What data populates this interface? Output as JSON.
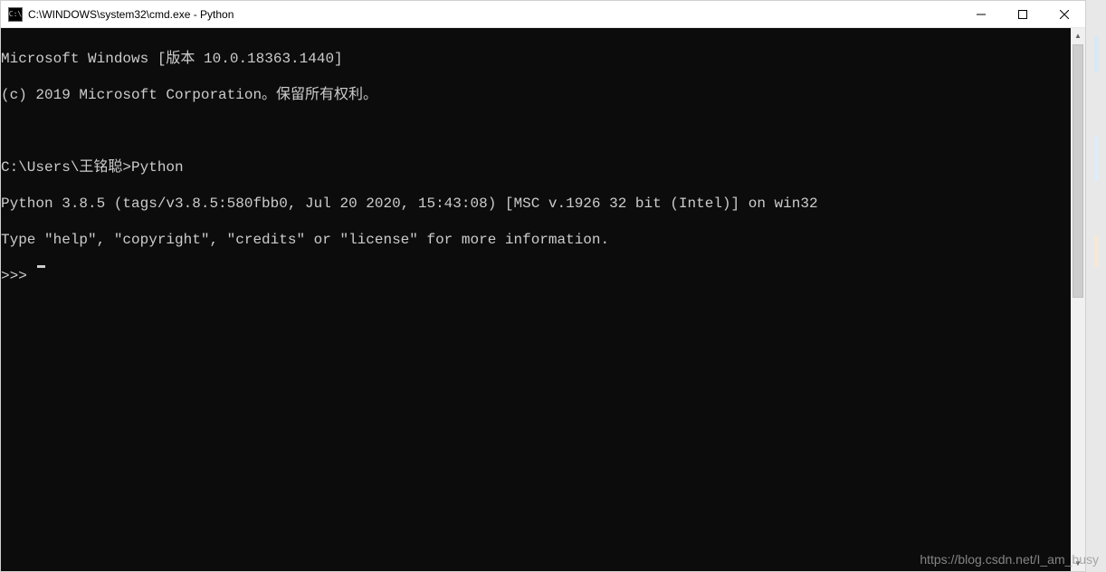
{
  "window": {
    "title": "C:\\WINDOWS\\system32\\cmd.exe - Python",
    "icon_label": "cmd-icon"
  },
  "terminal": {
    "lines": [
      "Microsoft Windows [版本 10.0.18363.1440]",
      "(c) 2019 Microsoft Corporation。保留所有权利。",
      "",
      "C:\\Users\\王铭聪>Python",
      "Python 3.8.5 (tags/v3.8.5:580fbb0, Jul 20 2020, 15:43:08) [MSC v.1926 32 bit (Intel)] on win32",
      "Type \"help\", \"copyright\", \"credits\" or \"license\" for more information."
    ],
    "prompt": ">>> "
  },
  "controls": {
    "minimize": "minimize",
    "maximize": "maximize",
    "close": "close"
  },
  "watermark": "https://blog.csdn.net/I_am_busy"
}
